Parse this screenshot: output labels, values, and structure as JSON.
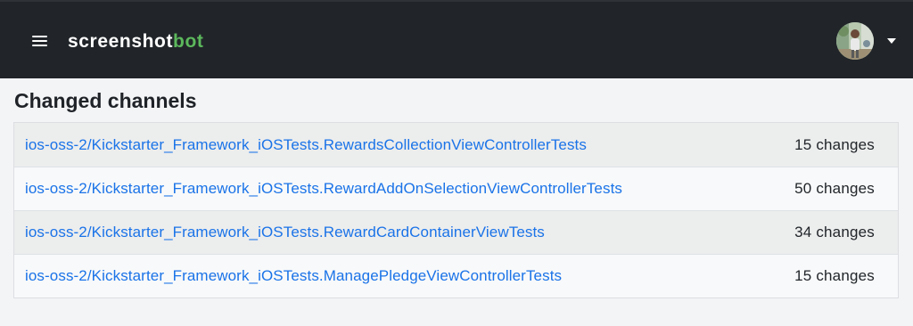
{
  "header": {
    "brand_primary": "screenshot",
    "brand_accent": "bot",
    "accent_color": "#5cb85c",
    "background_color": "#212529",
    "menu_icon": "hamburger-menu-icon",
    "user_icon": "user-avatar"
  },
  "main": {
    "title": "Changed channels",
    "link_color": "#1a73e8",
    "channels": [
      {
        "name": "ios-oss-2/Kickstarter_Framework_iOSTests.RewardsCollectionViewControllerTests",
        "changes": "15 changes"
      },
      {
        "name": "ios-oss-2/Kickstarter_Framework_iOSTests.RewardAddOnSelectionViewControllerTests",
        "changes": "50 changes"
      },
      {
        "name": "ios-oss-2/Kickstarter_Framework_iOSTests.RewardCardContainerViewTests",
        "changes": "34 changes"
      },
      {
        "name": "ios-oss-2/Kickstarter_Framework_iOSTests.ManagePledgeViewControllerTests",
        "changes": "15 changes"
      }
    ]
  }
}
